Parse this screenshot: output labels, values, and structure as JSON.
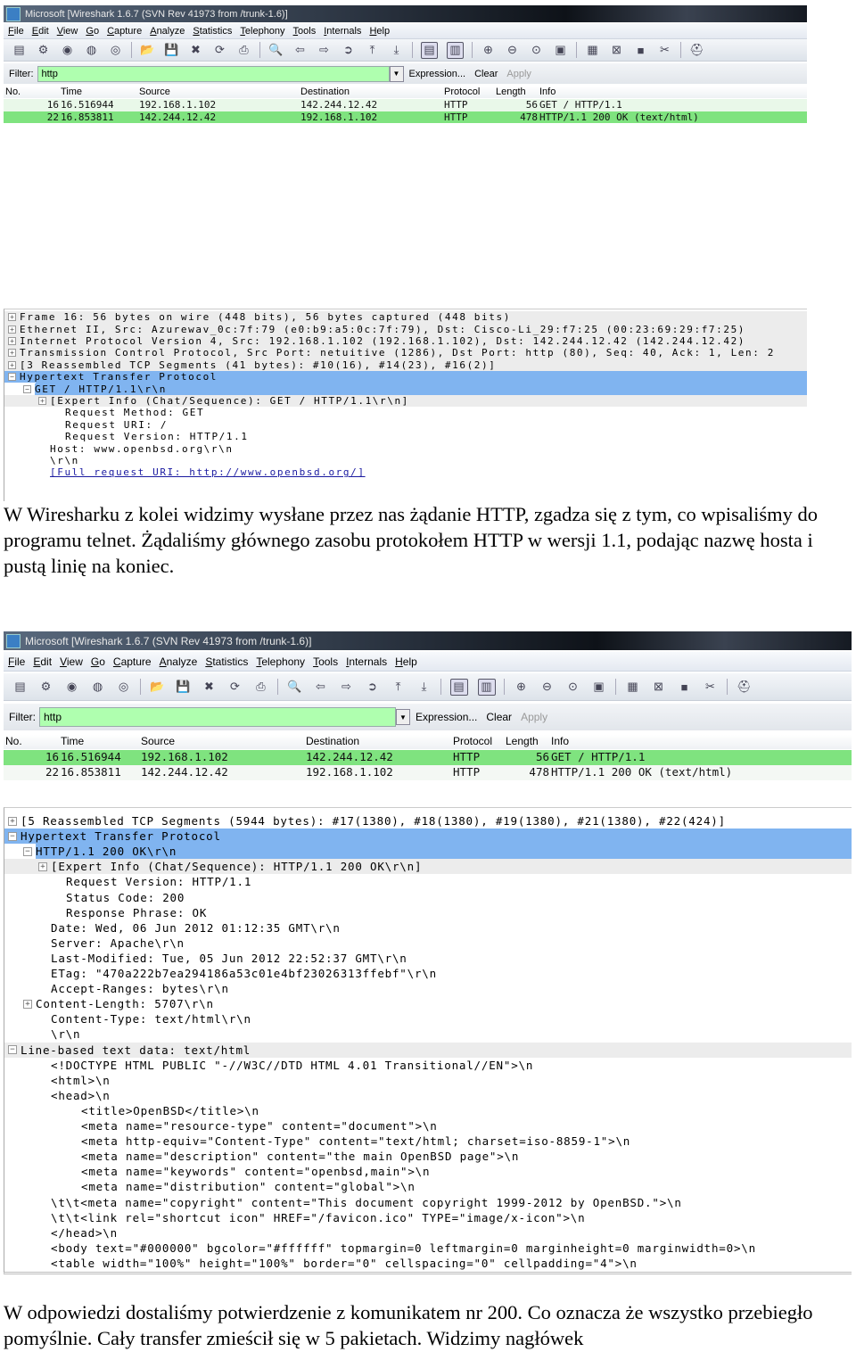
{
  "windows": [
    {
      "title": "Microsoft   [Wireshark 1.6.7  (SVN Rev 41973 from /trunk-1.6)]",
      "menu": [
        "File",
        "Edit",
        "View",
        "Go",
        "Capture",
        "Analyze",
        "Statistics",
        "Telephony",
        "Tools",
        "Internals",
        "Help"
      ],
      "toolbar": [
        "interface-list",
        "capture-options",
        "start-capture",
        "stop-capture",
        "restart-capture",
        "|",
        "open-file",
        "save-file",
        "close-file",
        "reload",
        "print",
        "|",
        "find-packet",
        "go-back",
        "go-forward",
        "go-to-packet",
        "go-first",
        "go-last",
        "|",
        "colorize",
        "auto-scroll",
        "|",
        "zoom-in",
        "zoom-out",
        "zoom-normal",
        "resize-columns",
        "|",
        "capture-filters",
        "display-filters",
        "coloring-rules",
        "preferences",
        "|",
        "help"
      ],
      "filter": {
        "label": "Filter:",
        "value": "http",
        "expression": "Expression...",
        "clear": "Clear",
        "apply": "Apply"
      },
      "columns": [
        "No.",
        "Time",
        "Source",
        "Destination",
        "Protocol",
        "Length",
        "Info"
      ],
      "packets": [
        {
          "no": "16",
          "time": "16.516944",
          "src": "192.168.1.102",
          "dst": "142.244.12.42",
          "proto": "HTTP",
          "len": "56",
          "info": "GET / HTTP/1.1",
          "bg": "#e9f8e9"
        },
        {
          "no": "22",
          "time": "16.853811",
          "src": "142.244.12.42",
          "dst": "192.168.1.102",
          "proto": "HTTP",
          "len": "478",
          "info": "HTTP/1.1 200 OK  (text/html)",
          "bg": "#7fe37f"
        }
      ],
      "details": [
        {
          "t": "Frame 16: 56 bytes on wire (448 bits), 56 bytes captured (448 bits)",
          "l": 0,
          "e": "+",
          "s": "top"
        },
        {
          "t": "Ethernet II, Src: Azurewav_0c:7f:79 (e0:b9:a5:0c:7f:79), Dst: Cisco-Li_29:f7:25 (00:23:69:29:f7:25)",
          "l": 0,
          "e": "+",
          "s": "top"
        },
        {
          "t": "Internet Protocol Version 4, Src: 192.168.1.102 (192.168.1.102), Dst: 142.244.12.42 (142.244.12.42)",
          "l": 0,
          "e": "+",
          "s": "top"
        },
        {
          "t": "Transmission Control Protocol, Src Port: netuitive (1286), Dst Port: http (80), Seq: 40, Ack: 1, Len: 2",
          "l": 0,
          "e": "+",
          "s": "top"
        },
        {
          "t": "[3 Reassembled TCP Segments (41 bytes): #10(16), #14(23), #16(2)]",
          "l": 0,
          "e": "+",
          "s": "top"
        },
        {
          "t": "Hypertext Transfer Protocol",
          "l": 0,
          "e": "-",
          "s": "sel"
        },
        {
          "t": "GET / HTTP/1.1\\r\\n",
          "l": 1,
          "e": "-",
          "s": "sel"
        },
        {
          "t": "[Expert Info (Chat/Sequence): GET / HTTP/1.1\\r\\n]",
          "l": 2,
          "e": "+",
          "s": "top"
        },
        {
          "t": "Request Method: GET",
          "l": 3,
          "e": "",
          "s": ""
        },
        {
          "t": "Request URI: /",
          "l": 3,
          "e": "",
          "s": ""
        },
        {
          "t": "Request Version: HTTP/1.1",
          "l": 3,
          "e": "",
          "s": ""
        },
        {
          "t": "Host: www.openbsd.org\\r\\n",
          "l": 2,
          "e": "",
          "s": ""
        },
        {
          "t": "\\r\\n",
          "l": 2,
          "e": "",
          "s": ""
        },
        {
          "t": "[Full request URI: http://www.openbsd.org/]",
          "l": 2,
          "e": "",
          "s": "link"
        }
      ]
    },
    {
      "title": "Microsoft   [Wireshark 1.6.7  (SVN Rev 41973 from /trunk-1.6)]",
      "menu": [
        "File",
        "Edit",
        "View",
        "Go",
        "Capture",
        "Analyze",
        "Statistics",
        "Telephony",
        "Tools",
        "Internals",
        "Help"
      ],
      "toolbar": [
        "interface-list",
        "capture-options",
        "start-capture",
        "stop-capture",
        "restart-capture",
        "|",
        "open-file",
        "save-file",
        "close-file",
        "reload",
        "print",
        "|",
        "find-packet",
        "go-back",
        "go-forward",
        "go-to-packet",
        "go-first",
        "go-last",
        "|",
        "colorize",
        "auto-scroll",
        "|",
        "zoom-in",
        "zoom-out",
        "zoom-normal",
        "resize-columns",
        "|",
        "capture-filters",
        "display-filters",
        "coloring-rules",
        "preferences",
        "|",
        "help"
      ],
      "filter": {
        "label": "Filter:",
        "value": "http",
        "expression": "Expression...",
        "clear": "Clear",
        "apply": "Apply"
      },
      "columns": [
        "No.",
        "Time",
        "Source",
        "Destination",
        "Protocol",
        "Length",
        "Info"
      ],
      "packets": [
        {
          "no": "16",
          "time": "16.516944",
          "src": "192.168.1.102",
          "dst": "142.244.12.42",
          "proto": "HTTP",
          "len": "56",
          "info": "GET / HTTP/1.1",
          "bg": "#7fe37f"
        },
        {
          "no": "22",
          "time": "16.853811",
          "src": "142.244.12.42",
          "dst": "192.168.1.102",
          "proto": "HTTP",
          "len": "478",
          "info": "HTTP/1.1 200 OK  (text/html)",
          "bg": "#f4f8f4"
        }
      ],
      "details": [
        {
          "t": "[5 Reassembled TCP Segments (5944 bytes): #17(1380), #18(1380), #19(1380), #21(1380), #22(424)]",
          "l": 0,
          "e": "+",
          "s": ""
        },
        {
          "t": "Hypertext Transfer Protocol",
          "l": 0,
          "e": "-",
          "s": "sel"
        },
        {
          "t": "HTTP/1.1 200 OK\\r\\n",
          "l": 1,
          "e": "-",
          "s": "sel"
        },
        {
          "t": "[Expert Info (Chat/Sequence): HTTP/1.1 200 OK\\r\\n]",
          "l": 2,
          "e": "+",
          "s": "top"
        },
        {
          "t": "Request Version: HTTP/1.1",
          "l": 3,
          "e": "",
          "s": ""
        },
        {
          "t": "Status Code: 200",
          "l": 3,
          "e": "",
          "s": ""
        },
        {
          "t": "Response Phrase: OK",
          "l": 3,
          "e": "",
          "s": ""
        },
        {
          "t": "Date: Wed, 06 Jun 2012 01:12:35 GMT\\r\\n",
          "l": 2,
          "e": "",
          "s": ""
        },
        {
          "t": "Server: Apache\\r\\n",
          "l": 2,
          "e": "",
          "s": ""
        },
        {
          "t": "Last-Modified: Tue, 05 Jun 2012 22:52:37 GMT\\r\\n",
          "l": 2,
          "e": "",
          "s": ""
        },
        {
          "t": "ETag: \"470a222b7ea294186a53c01e4bf23026313ffebf\"\\r\\n",
          "l": 2,
          "e": "",
          "s": ""
        },
        {
          "t": "Accept-Ranges: bytes\\r\\n",
          "l": 2,
          "e": "",
          "s": ""
        },
        {
          "t": "Content-Length: 5707\\r\\n",
          "l": 1,
          "e": "+",
          "s": ""
        },
        {
          "t": "Content-Type: text/html\\r\\n",
          "l": 2,
          "e": "",
          "s": ""
        },
        {
          "t": "\\r\\n",
          "l": 2,
          "e": "",
          "s": ""
        },
        {
          "t": "Line-based text data: text/html",
          "l": 0,
          "e": "-",
          "s": "top"
        },
        {
          "t": "<!DOCTYPE HTML PUBLIC \"-//W3C//DTD HTML 4.01 Transitional//EN\">\\n",
          "l": 2,
          "e": "",
          "s": ""
        },
        {
          "t": "<html>\\n",
          "l": 2,
          "e": "",
          "s": ""
        },
        {
          "t": "<head>\\n",
          "l": 2,
          "e": "",
          "s": ""
        },
        {
          "t": "<title>OpenBSD</title>\\n",
          "l": 4,
          "e": "",
          "s": ""
        },
        {
          "t": "<meta name=\"resource-type\" content=\"document\">\\n",
          "l": 4,
          "e": "",
          "s": ""
        },
        {
          "t": "<meta http-equiv=\"Content-Type\" content=\"text/html; charset=iso-8859-1\">\\n",
          "l": 4,
          "e": "",
          "s": ""
        },
        {
          "t": "<meta name=\"description\" content=\"the main OpenBSD page\">\\n",
          "l": 4,
          "e": "",
          "s": ""
        },
        {
          "t": "<meta name=\"keywords\" content=\"openbsd,main\">\\n",
          "l": 4,
          "e": "",
          "s": ""
        },
        {
          "t": "<meta name=\"distribution\" content=\"global\">\\n",
          "l": 4,
          "e": "",
          "s": ""
        },
        {
          "t": "\\t\\t<meta name=\"copyright\" content=\"This document copyright 1999-2012 by OpenBSD.\">\\n",
          "l": 2,
          "e": "",
          "s": ""
        },
        {
          "t": "\\t\\t<link rel=\"shortcut icon\" HREF=\"/favicon.ico\" TYPE=\"image/x-icon\">\\n",
          "l": 2,
          "e": "",
          "s": ""
        },
        {
          "t": "</head>\\n",
          "l": 2,
          "e": "",
          "s": ""
        },
        {
          "t": "<body text=\"#000000\" bgcolor=\"#ffffff\" topmargin=0 leftmargin=0 marginheight=0 marginwidth=0>\\n",
          "l": 2,
          "e": "",
          "s": ""
        },
        {
          "t": "<table width=\"100%\" height=\"100%\" border=\"0\" cellspacing=\"0\" cellpadding=\"4\">\\n",
          "l": 2,
          "e": "",
          "s": ""
        }
      ]
    }
  ],
  "paragraphs": [
    "W Wiresharku z kolei widzimy wysłane przez nas żądanie HTTP, zgadza się z tym, co wpisaliśmy do programu telnet. Żądaliśmy głównego zasobu protokołem HTTP w wersji 1.1, podając nazwę hosta i pustą linię na koniec.",
    "W odpowiedzi dostaliśmy potwierdzenie z komunikatem nr 200. Co oznacza że wszystko przebiegło pomyślnie. Cały transfer zmieścił się w 5 pakietach. Widzimy nagłówek"
  ],
  "colors": {
    "filter_ok": "#afffaf",
    "selected": "#80b4f0",
    "http_row": "#7fe37f"
  }
}
